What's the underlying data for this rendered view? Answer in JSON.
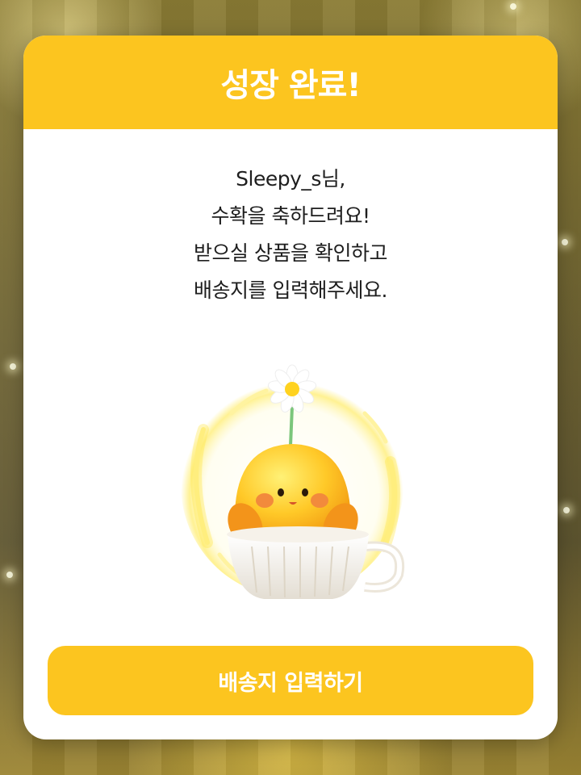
{
  "dialog": {
    "title": "성장 완료!",
    "message_lines": [
      "Sleepy_s님,",
      "수확을 축하드려요!",
      "받으실 상품을 확인하고",
      "배송지를 입력해주세요."
    ],
    "illustration": "yellow-chick-in-teacup-with-daisy",
    "cta_label": "배송지 입력하기"
  },
  "colors": {
    "accent": "#fcc51f",
    "card": "#ffffff",
    "text": "#1e1e1e",
    "button_text": "#ffffff"
  }
}
